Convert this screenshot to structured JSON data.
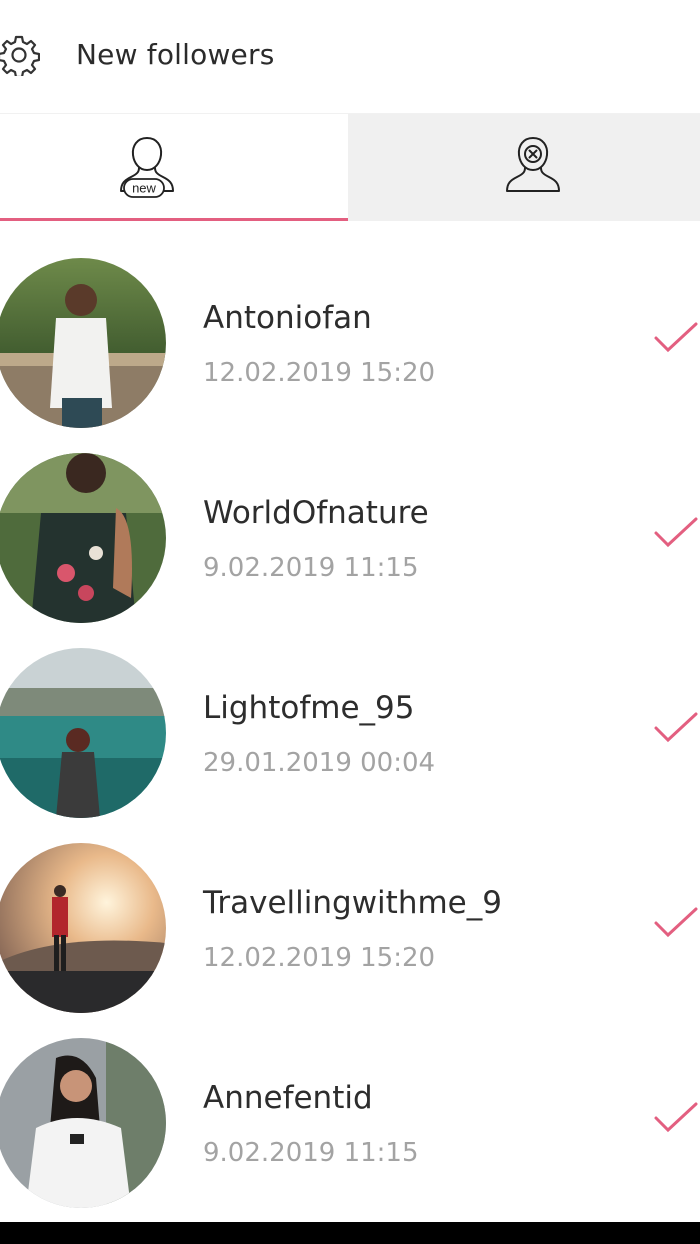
{
  "header": {
    "title": "New followers",
    "settings_icon": "gear-icon"
  },
  "tabs": [
    {
      "id": "new",
      "icon": "new-user-icon",
      "badge": "new",
      "active": true
    },
    {
      "id": "unfollowers",
      "icon": "removed-user-icon",
      "active": false
    }
  ],
  "colors": {
    "accent": "#e35f80",
    "date_text": "#a3a3a3",
    "inactive_tab_bg": "#f0f0f0"
  },
  "followers": [
    {
      "name": "Antoniofan",
      "date": "12.02.2019 15:20",
      "followed": true
    },
    {
      "name": "WorldOfnature",
      "date": "9.02.2019 11:15",
      "followed": true
    },
    {
      "name": "Lightofme_95",
      "date": "29.01.2019 00:04",
      "followed": true
    },
    {
      "name": "Travellingwithme_9",
      "date": "12.02.2019 15:20",
      "followed": true
    },
    {
      "name": "Annefentid",
      "date": "9.02.2019 11:15",
      "followed": true
    }
  ]
}
